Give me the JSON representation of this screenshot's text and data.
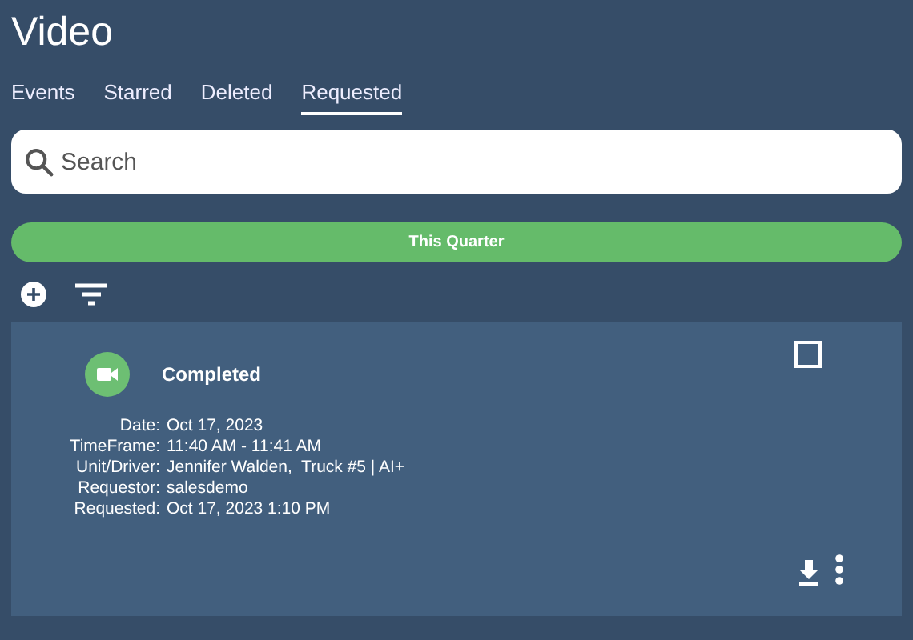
{
  "header": {
    "title": "Video"
  },
  "tabs": [
    {
      "label": "Events",
      "selected": false
    },
    {
      "label": "Starred",
      "selected": false
    },
    {
      "label": "Deleted",
      "selected": false
    },
    {
      "label": "Requested",
      "selected": true
    }
  ],
  "search": {
    "placeholder": "Search"
  },
  "period_button": {
    "label": "This Quarter"
  },
  "requests": [
    {
      "status": "Completed",
      "checked": false,
      "details": [
        {
          "label": "Date:",
          "value": "Oct 17, 2023"
        },
        {
          "label": "TimeFrame:",
          "value": "11:40 AM - 11:41 AM"
        },
        {
          "label": "Unit/Driver:",
          "value": "Jennifer Walden,  Truck #5 | AI+"
        },
        {
          "label": "Requestor:",
          "value": "salesdemo"
        },
        {
          "label": "Requested:",
          "value": "Oct 17, 2023 1:10 PM"
        }
      ]
    }
  ]
}
